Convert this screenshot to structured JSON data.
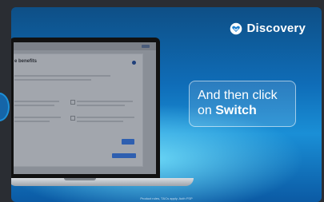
{
  "brand": {
    "name": "Discovery",
    "icon": "discovery-heart-icon"
  },
  "callout": {
    "line1": "And then click",
    "line2_prefix": "on ",
    "line2_emphasis": "Switch"
  },
  "screen": {
    "dialog_title": "e benefits"
  },
  "footnote": "Product rules, T&Cs apply. Auth FSP",
  "colors": {
    "background_top": "#0e4f86",
    "background_glow": "#78e6ff",
    "accent_button": "#2e5fb0",
    "text": "#ffffff"
  }
}
